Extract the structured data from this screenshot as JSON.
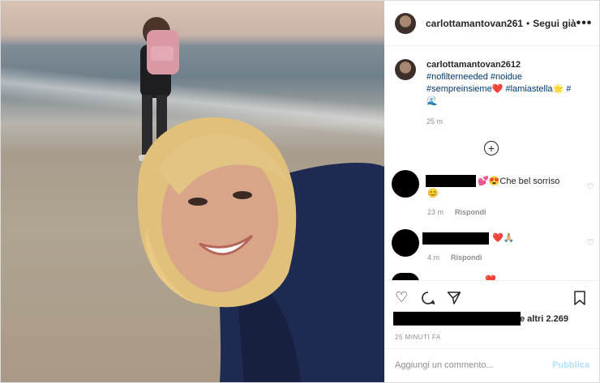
{
  "header": {
    "username": "carlottamantovan261",
    "separator": "•",
    "follow_label": "Segui già",
    "more_label": "•••"
  },
  "caption": {
    "username": "carlottamantovan2612",
    "lines": [
      "#nofilterneeded #noidue",
      "#sempreinsieme❤️ #lamiastella🌟 #",
      "🌊"
    ],
    "time": "25 m"
  },
  "add_icon": "plus-circle-icon",
  "comments": [
    {
      "text": "💕😍Che bel sorriso",
      "emoji_line": "😊",
      "time": "23 m",
      "reply": "Rispondi",
      "like_icon": "heart-outline-icon"
    },
    {
      "text": "❤️🙏🏼",
      "time": "4 m",
      "reply": "Rispondi",
      "like_icon": "heart-outline-icon"
    },
    {
      "text": "❤️"
    }
  ],
  "actions": {
    "like": "heart-icon",
    "comment": "comment-icon",
    "share": "send-icon",
    "save": "bookmark-icon"
  },
  "likes_text": "e altri 2.269",
  "posted_ago": "25 MINUTI FA",
  "comment_input_placeholder": "Aggiungi un commento...",
  "publish_label": "Pubblica",
  "colors": {
    "link": "#00376b",
    "muted": "#8e8e8e",
    "publish": "#b2dffc"
  }
}
